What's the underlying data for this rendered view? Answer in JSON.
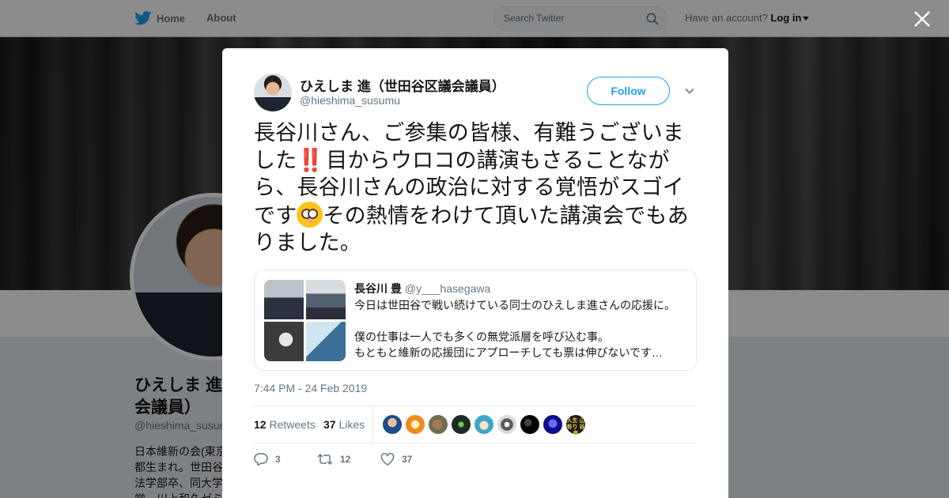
{
  "topbar": {
    "home_label": "Home",
    "about_label": "About",
    "search_placeholder": "Search Twitter",
    "account_prompt": "Have an account?",
    "login_label": "Log in"
  },
  "profile": {
    "name_line1": "ひえしま 進",
    "name_line2": "会議員）",
    "handle": "@hieshima_susum",
    "bio_lines": [
      "日本維新の会(東京",
      "都生まれ。世田谷",
      "法学部卒、同大学",
      "覚　川上和久ゼミ"
    ]
  },
  "tweet": {
    "author_name": "ひえしま 進（世田谷区議会議員）",
    "author_handle": "@hieshima_susumu",
    "follow_label": "Follow",
    "text_part1": "長谷川さん、ご参集の皆様、有難うございました",
    "emoji1": "‼️",
    "text_part2": "目からウロコの講演もさることながら、長谷川さんの政治に対する覚悟がスゴイです",
    "emoji2": "😳",
    "text_part3": "その熱情をわけて頂いた講演会でもありました。",
    "timestamp": "7:44 PM - 24 Feb 2019",
    "retweet_count": "12",
    "retweets_label": "Retweets",
    "like_count": "37",
    "likes_label": "Likes",
    "reply_count": "3",
    "action_retweet_count": "12",
    "action_like_count": "37"
  },
  "quoted_tweet": {
    "author_name": "長谷川 豊",
    "author_handle": "@y___hasegawa",
    "body": "今日は世田谷で戦い続けている同士のひえしま進さんの応援に。\n\n僕の仕事は一人でも多くの無党派層を呼び込む事。\nもともと維新の応援団にアプローチしても票は伸びないです…"
  },
  "likers_badge_text": "人生 山有り 谷有",
  "colors": {
    "twitter_blue": "#1da1f2",
    "secondary_text": "#657786",
    "primary_text": "#14171a"
  },
  "icons": [
    "twitter-bird-icon",
    "search-icon",
    "close-icon",
    "chevron-down-icon",
    "reply-icon",
    "retweet-icon",
    "heart-icon"
  ]
}
